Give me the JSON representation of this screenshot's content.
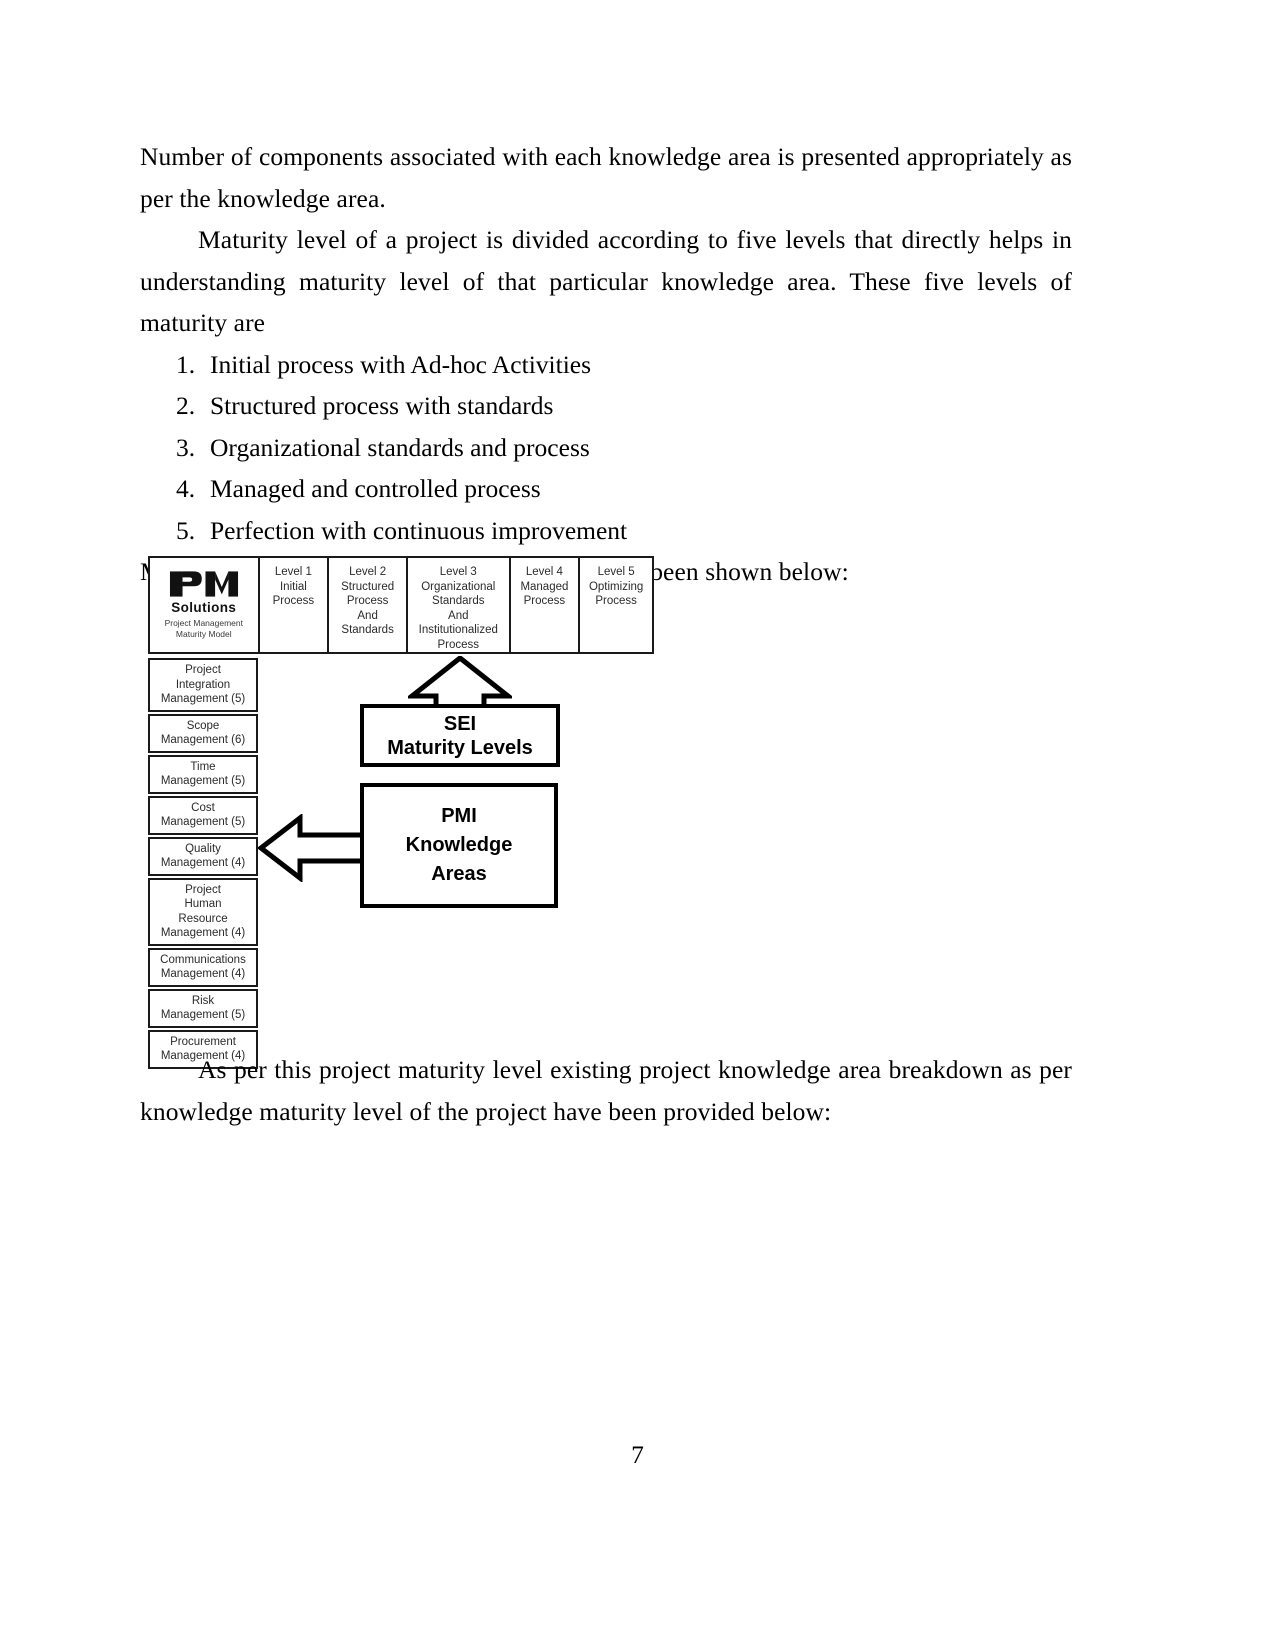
{
  "document": {
    "page_number": "7",
    "paragraphs": {
      "p1": "Number of components associated with each knowledge area is presented appropriately as per the knowledge area.",
      "p2": "Maturity level of a project is divided according to five levels that directly helps in understanding maturity level of that particular knowledge area. These five levels of maturity are",
      "p3": "Maturity model as per PMI knowledge area have been shown below:",
      "p4": "As per this project maturity level existing project knowledge area breakdown as per knowledge maturity level of the project have been provided below:"
    },
    "maturity_levels_list": [
      "Initial process with Ad-hoc Activities",
      "Structured process with standards",
      "Organizational standards and process",
      "Managed and controlled process",
      "Perfection with continuous improvement"
    ]
  },
  "figure": {
    "logo": {
      "mark": "PM",
      "brand": "Solutions",
      "subtitle_line1": "Project Management",
      "subtitle_line2": "Maturity Model"
    },
    "level_headers": [
      {
        "level": "Level 1",
        "description": "Initial\nProcess"
      },
      {
        "level": "Level 2",
        "description": "Structured\nProcess\nAnd\nStandards"
      },
      {
        "level": "Level 3",
        "description": "Organizational\nStandards\nAnd\nInstitutionalized\nProcess"
      },
      {
        "level": "Level 4",
        "description": "Managed\nProcess"
      },
      {
        "level": "Level 5",
        "description": "Optimizing\nProcess"
      }
    ],
    "knowledge_areas": [
      "Project\nIntegration\nManagement (5)",
      "Scope\nManagement (6)",
      "Time\nManagement (5)",
      "Cost\nManagement (5)",
      "Quality\nManagement (4)",
      "Project\nHuman\nResource\nManagement (4)",
      "Communications\nManagement (4)",
      "Risk\nManagement (5)",
      "Procurement\nManagement (4)"
    ],
    "callouts": {
      "sei": "SEI\nMaturity Levels",
      "pmi": "PMI\nKnowledge\nAreas"
    },
    "colors": {
      "ink": "#000000",
      "box_border": "#1a1a1a",
      "paper": "#ffffff"
    }
  }
}
